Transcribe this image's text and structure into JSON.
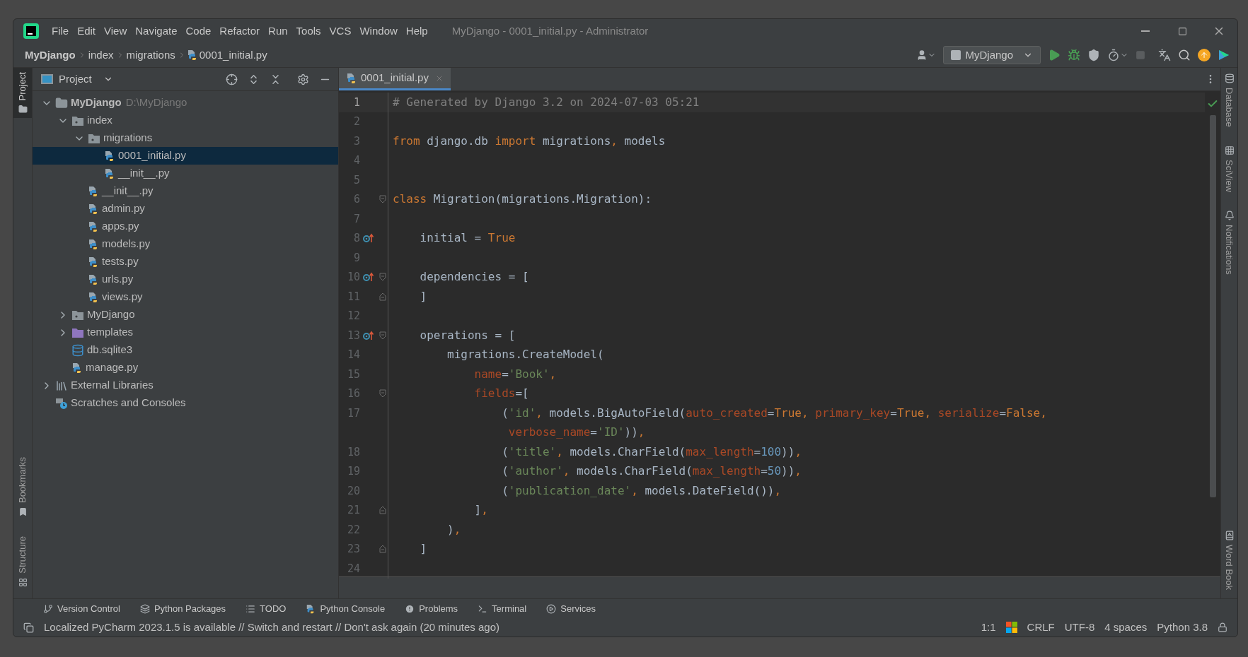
{
  "window": {
    "title": "MyDjango - 0001_initial.py - Administrator"
  },
  "menu": [
    "File",
    "Edit",
    "View",
    "Navigate",
    "Code",
    "Refactor",
    "Run",
    "Tools",
    "VCS",
    "Window",
    "Help"
  ],
  "breadcrumbs": [
    "MyDjango",
    "index",
    "migrations",
    "0001_initial.py"
  ],
  "run_configuration": "MyDjango",
  "left_stripe": {
    "top": [
      {
        "label": "Project",
        "selected": true
      }
    ],
    "bottom": [
      {
        "label": "Bookmarks",
        "selected": false
      },
      {
        "label": "Structure",
        "selected": false
      }
    ]
  },
  "project_panel": {
    "title": "Project",
    "tree": [
      {
        "label": "MyDjango",
        "path": "D:\\MyDjango",
        "kind": "folder",
        "expanded": true,
        "selected": false,
        "children": [
          {
            "label": "index",
            "kind": "package",
            "expanded": true,
            "selected": false,
            "children": [
              {
                "label": "migrations",
                "kind": "package",
                "expanded": true,
                "selected": false,
                "children": [
                  {
                    "label": "0001_initial.py",
                    "kind": "python",
                    "selected": true
                  },
                  {
                    "label": "__init__.py",
                    "kind": "python",
                    "selected": false
                  }
                ]
              },
              {
                "label": "__init__.py",
                "kind": "python",
                "selected": false
              },
              {
                "label": "admin.py",
                "kind": "python",
                "selected": false
              },
              {
                "label": "apps.py",
                "kind": "python",
                "selected": false
              },
              {
                "label": "models.py",
                "kind": "python",
                "selected": false
              },
              {
                "label": "tests.py",
                "kind": "python",
                "selected": false
              },
              {
                "label": "urls.py",
                "kind": "python",
                "selected": false
              },
              {
                "label": "views.py",
                "kind": "python",
                "selected": false
              }
            ]
          },
          {
            "label": "MyDjango",
            "kind": "package",
            "expanded": false,
            "selected": false
          },
          {
            "label": "templates",
            "kind": "templates",
            "expanded": false,
            "selected": false
          },
          {
            "label": "db.sqlite3",
            "kind": "database",
            "selected": false
          },
          {
            "label": "manage.py",
            "kind": "python",
            "selected": false
          }
        ]
      },
      {
        "label": "External Libraries",
        "kind": "libraries",
        "expanded": false,
        "selected": false
      },
      {
        "label": "Scratches and Consoles",
        "kind": "scratches",
        "selected": false
      }
    ]
  },
  "editor": {
    "tabs": [
      {
        "label": "0001_initial.py",
        "selected": true
      }
    ],
    "lines": [
      {
        "number": "1",
        "current": true,
        "tokens": [
          {
            "kind": "comment",
            "text": "# Generated by Django 3.2 on 2024-07-03 05:21"
          }
        ]
      },
      {
        "number": "2",
        "current": false
      },
      {
        "number": "3",
        "current": false,
        "tokens": [
          {
            "kind": "keyword",
            "text": "from"
          },
          {
            "kind": "plain",
            "text": " django.db "
          },
          {
            "kind": "keyword",
            "text": "import"
          },
          {
            "kind": "plain",
            "text": " migrations"
          },
          {
            "kind": "keyword",
            "text": ","
          },
          {
            "kind": "plain",
            "text": " models"
          }
        ]
      },
      {
        "number": "4",
        "current": false
      },
      {
        "number": "5",
        "current": false
      },
      {
        "number": "6",
        "current": false,
        "fold_open": true,
        "tokens": [
          {
            "kind": "keyword",
            "text": "class"
          },
          {
            "kind": "plain",
            "text": " Migration(migrations.Migration):"
          }
        ]
      },
      {
        "number": "7",
        "current": false
      },
      {
        "number": "8",
        "current": false,
        "override": true,
        "tokens": [
          {
            "kind": "plain",
            "text": "    initial = "
          },
          {
            "kind": "keyword",
            "text": "True"
          }
        ]
      },
      {
        "number": "9",
        "current": false
      },
      {
        "number": "10",
        "current": false,
        "override": true,
        "fold_open": true,
        "tokens": [
          {
            "kind": "plain",
            "text": "    dependencies = ["
          }
        ]
      },
      {
        "number": "11",
        "current": false,
        "fold_close": true,
        "tokens": [
          {
            "kind": "plain",
            "text": "    ]"
          }
        ]
      },
      {
        "number": "12",
        "current": false
      },
      {
        "number": "13",
        "current": false,
        "override": true,
        "fold_open": true,
        "tokens": [
          {
            "kind": "plain",
            "text": "    operations = ["
          }
        ]
      },
      {
        "number": "14",
        "current": false,
        "tokens": [
          {
            "kind": "plain",
            "text": "        migrations.CreateModel("
          }
        ]
      },
      {
        "number": "15",
        "current": false,
        "tokens": [
          {
            "kind": "param",
            "text": "            name"
          },
          {
            "kind": "plain",
            "text": "="
          },
          {
            "kind": "string",
            "text": "'Book'"
          },
          {
            "kind": "keyword",
            "text": ","
          }
        ]
      },
      {
        "number": "16",
        "current": false,
        "fold_open": true,
        "tokens": [
          {
            "kind": "param",
            "text": "            fields"
          },
          {
            "kind": "plain",
            "text": "=["
          }
        ]
      },
      {
        "number": "17",
        "current": false,
        "tokens": [
          {
            "kind": "plain",
            "text": "                ("
          },
          {
            "kind": "string",
            "text": "'id'"
          },
          {
            "kind": "keyword",
            "text": ","
          },
          {
            "kind": "plain",
            "text": " models.BigAutoField("
          },
          {
            "kind": "param",
            "text": "auto_created"
          },
          {
            "kind": "plain",
            "text": "="
          },
          {
            "kind": "keyword",
            "text": "True"
          },
          {
            "kind": "keyword",
            "text": ", "
          },
          {
            "kind": "param",
            "text": "primary_key"
          },
          {
            "kind": "plain",
            "text": "="
          },
          {
            "kind": "keyword",
            "text": "True"
          },
          {
            "kind": "keyword",
            "text": ", "
          },
          {
            "kind": "param",
            "text": "serialize"
          },
          {
            "kind": "plain",
            "text": "="
          },
          {
            "kind": "keyword",
            "text": "False"
          },
          {
            "kind": "keyword",
            "text": ","
          }
        ]
      },
      {
        "tokens": [
          {
            "kind": "param",
            "text": "                 verbose_name"
          },
          {
            "kind": "plain",
            "text": "="
          },
          {
            "kind": "string",
            "text": "'ID'"
          },
          {
            "kind": "plain",
            "text": "))"
          },
          {
            "kind": "keyword",
            "text": ","
          }
        ]
      },
      {
        "number": "18",
        "current": false,
        "tokens": [
          {
            "kind": "plain",
            "text": "                ("
          },
          {
            "kind": "string",
            "text": "'title'"
          },
          {
            "kind": "keyword",
            "text": ","
          },
          {
            "kind": "plain",
            "text": " models.CharField("
          },
          {
            "kind": "param",
            "text": "max_length"
          },
          {
            "kind": "plain",
            "text": "="
          },
          {
            "kind": "number",
            "text": "100"
          },
          {
            "kind": "plain",
            "text": "))"
          },
          {
            "kind": "keyword",
            "text": ","
          }
        ]
      },
      {
        "number": "19",
        "current": false,
        "tokens": [
          {
            "kind": "plain",
            "text": "                ("
          },
          {
            "kind": "string",
            "text": "'author'"
          },
          {
            "kind": "keyword",
            "text": ","
          },
          {
            "kind": "plain",
            "text": " models.CharField("
          },
          {
            "kind": "param",
            "text": "max_length"
          },
          {
            "kind": "plain",
            "text": "="
          },
          {
            "kind": "number",
            "text": "50"
          },
          {
            "kind": "plain",
            "text": "))"
          },
          {
            "kind": "keyword",
            "text": ","
          }
        ]
      },
      {
        "number": "20",
        "current": false,
        "tokens": [
          {
            "kind": "plain",
            "text": "                ("
          },
          {
            "kind": "string",
            "text": "'publication_date'"
          },
          {
            "kind": "keyword",
            "text": ","
          },
          {
            "kind": "plain",
            "text": " models.DateField())"
          },
          {
            "kind": "keyword",
            "text": ","
          }
        ]
      },
      {
        "number": "21",
        "current": false,
        "fold_close": true,
        "tokens": [
          {
            "kind": "plain",
            "text": "            ]"
          },
          {
            "kind": "keyword",
            "text": ","
          }
        ]
      },
      {
        "number": "22",
        "current": false,
        "tokens": [
          {
            "kind": "plain",
            "text": "        )"
          },
          {
            "kind": "keyword",
            "text": ","
          }
        ]
      },
      {
        "number": "23",
        "current": false,
        "fold_close": true,
        "tokens": [
          {
            "kind": "plain",
            "text": "    ]"
          }
        ]
      },
      {
        "number": "24",
        "current": false
      }
    ]
  },
  "right_stripe": {
    "top": [
      {
        "label": "Database",
        "kind": "database"
      },
      {
        "label": "SciView",
        "kind": "grid"
      },
      {
        "label": "Notifications",
        "kind": "bell"
      }
    ],
    "bottom": [
      {
        "label": "Word Book",
        "kind": "book"
      }
    ]
  },
  "tool_windows": [
    {
      "label": "Version Control",
      "kind": "vcs"
    },
    {
      "label": "Python Packages",
      "kind": "packages"
    },
    {
      "label": "TODO",
      "kind": "list"
    },
    {
      "label": "Python Console",
      "kind": "python"
    },
    {
      "label": "Problems",
      "kind": "problems"
    },
    {
      "label": "Terminal",
      "kind": "terminal"
    },
    {
      "label": "Services",
      "kind": "services"
    }
  ],
  "status_bar": {
    "message": "Localized PyCharm 2023.1.5 is available // Switch and restart // Don't ask again (20 minutes ago)",
    "caret": "1:1",
    "line_separator": "CRLF",
    "encoding": "UTF-8",
    "indent": "4 spaces",
    "interpreter": "Python 3.8"
  }
}
